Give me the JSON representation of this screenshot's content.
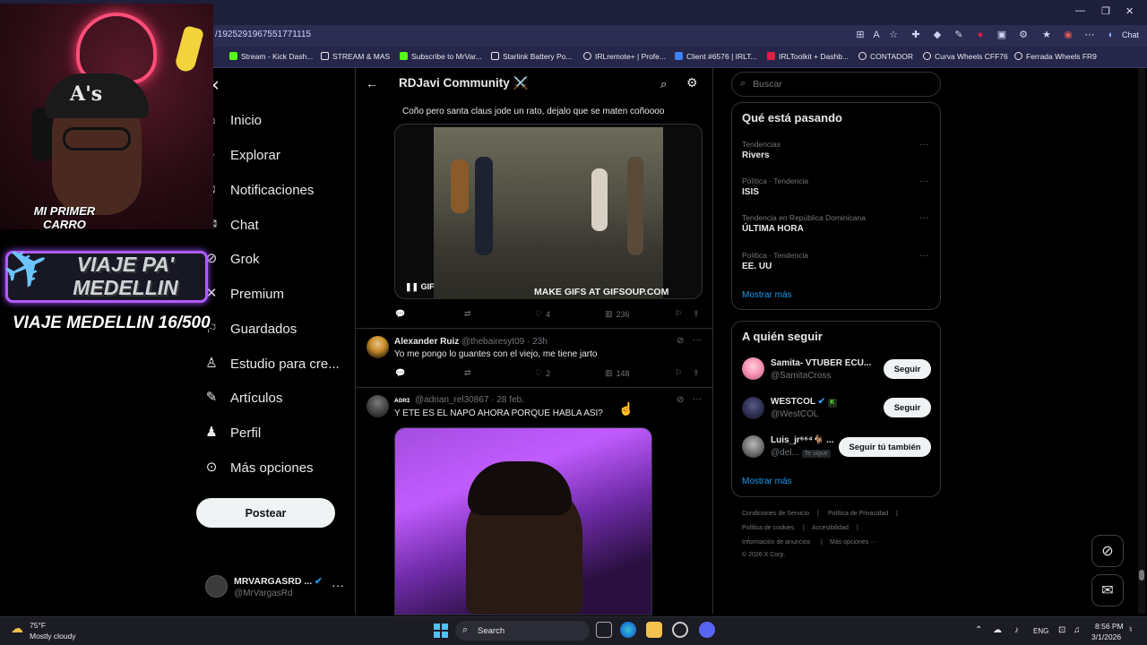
{
  "browser": {
    "url": "/1925291967551771115",
    "bookmarks": [
      {
        "label": "Stream - Kick Dash...",
        "color": "#53fc18"
      },
      {
        "label": "STREAM & MAS",
        "color": "#e7e9ea"
      },
      {
        "label": "Subscribe to MrVar...",
        "color": "#53fc18"
      },
      {
        "label": "Starlink Battery Po...",
        "color": "#e7e9ea"
      },
      {
        "label": "IRLremote+ | Profe...",
        "color": "#e7e9ea"
      },
      {
        "label": "Client #6576 | IRLT...",
        "color": "#3b82f6"
      },
      {
        "label": "IRLToolkit + Dashb...",
        "color": "#e11d48"
      },
      {
        "label": "CONTADOR",
        "color": "#e7e9ea"
      },
      {
        "label": "Curva Wheels CFF76",
        "color": "#e7e9ea"
      },
      {
        "label": "Ferrada Wheels FR9",
        "color": "#e7e9ea"
      }
    ],
    "chat_label": "Chat"
  },
  "overlay": {
    "cap_text": "A's",
    "car_badge": "MI PRIMER CARRO",
    "trip_title": "VIAJE PA' MEDELLIN",
    "trip_count": "VIAJE MEDELLIN 16/500"
  },
  "nav": {
    "items": [
      {
        "label": "Inicio",
        "icon": "home-icon"
      },
      {
        "label": "Explorar",
        "icon": "search-icon"
      },
      {
        "label": "Notificaciones",
        "icon": "bell-icon"
      },
      {
        "label": "Chat",
        "icon": "chat-icon"
      },
      {
        "label": "Grok",
        "icon": "grok-icon"
      },
      {
        "label": "Premium",
        "icon": "x-premium-icon"
      },
      {
        "label": "Guardados",
        "icon": "bookmark-icon"
      },
      {
        "label": "Estudio para cre...",
        "icon": "studio-icon"
      },
      {
        "label": "Artículos",
        "icon": "articles-icon"
      },
      {
        "label": "Perfil",
        "icon": "person-icon"
      },
      {
        "label": "Más opciones",
        "icon": "more-circle-icon"
      }
    ],
    "post_button": "Postear",
    "account": {
      "name": "MRVARGASRD ...",
      "handle": "@MrVargasRd"
    }
  },
  "community": {
    "title": "RDJavi Community ⚔️"
  },
  "tweets": [
    {
      "text": "Coño pero santa claus jode un rato, dejalo que se maten coñoooo",
      "gif_watermark": "MAKE GIFS AT GIFSOUP.COM",
      "gif_label": "GIF",
      "likes": "4",
      "views": "236"
    },
    {
      "name": "Alexander Ruiz",
      "handle": "@thebairesyt09 · 23h",
      "text": "Yo me pongo lo guantes con el viejo, me tiene jarto",
      "likes": "2",
      "views": "148"
    },
    {
      "name": "ᴀᴅʀɪ",
      "handle": "@adrian_rel30867 · 28 feb.",
      "text": "Y ETE ES EL NAPO AHORA PORQUE HABLA ASI?"
    }
  ],
  "right": {
    "search_placeholder": "Buscar",
    "trending_title": "Qué está pasando",
    "trends": [
      {
        "category": "Tendencias",
        "name": "Rivers"
      },
      {
        "category": "Política · Tendencia",
        "name": "ISIS"
      },
      {
        "category": "Tendencia en República Dominicana",
        "name": "ÚLTIMA HORA"
      },
      {
        "category": "Política · Tendencia",
        "name": "EE. UU"
      }
    ],
    "show_more": "Mostrar más",
    "follow_title": "A quién seguir",
    "follows": [
      {
        "name": "Samita- VTUBER ECU...",
        "handle": "@SamitaCross",
        "button": "Seguir"
      },
      {
        "name": "WESTCOL",
        "handle": "@WestCOL",
        "button": "Seguir"
      },
      {
        "name": "Luis_jr⁶⁶⁴🐐 ...",
        "handle": "@del...",
        "follows_you": "Te sigue",
        "button": "Seguir tú también"
      }
    ],
    "footer": [
      "Condiciones de Servicio",
      "Política de Privacidad",
      "Política de cookies",
      "Accesibilidad",
      "Información de anuncios",
      "Más opciones ···",
      "© 2026 X Corp."
    ]
  },
  "taskbar": {
    "temp": "75°F",
    "weather": "Mostly cloudy",
    "search": "Search",
    "lang": "ENG",
    "time": "8:56 PM",
    "date": "3/1/2026"
  },
  "colors": {
    "accent": "#1d9bf0",
    "verified_gold": "#e8b923"
  }
}
